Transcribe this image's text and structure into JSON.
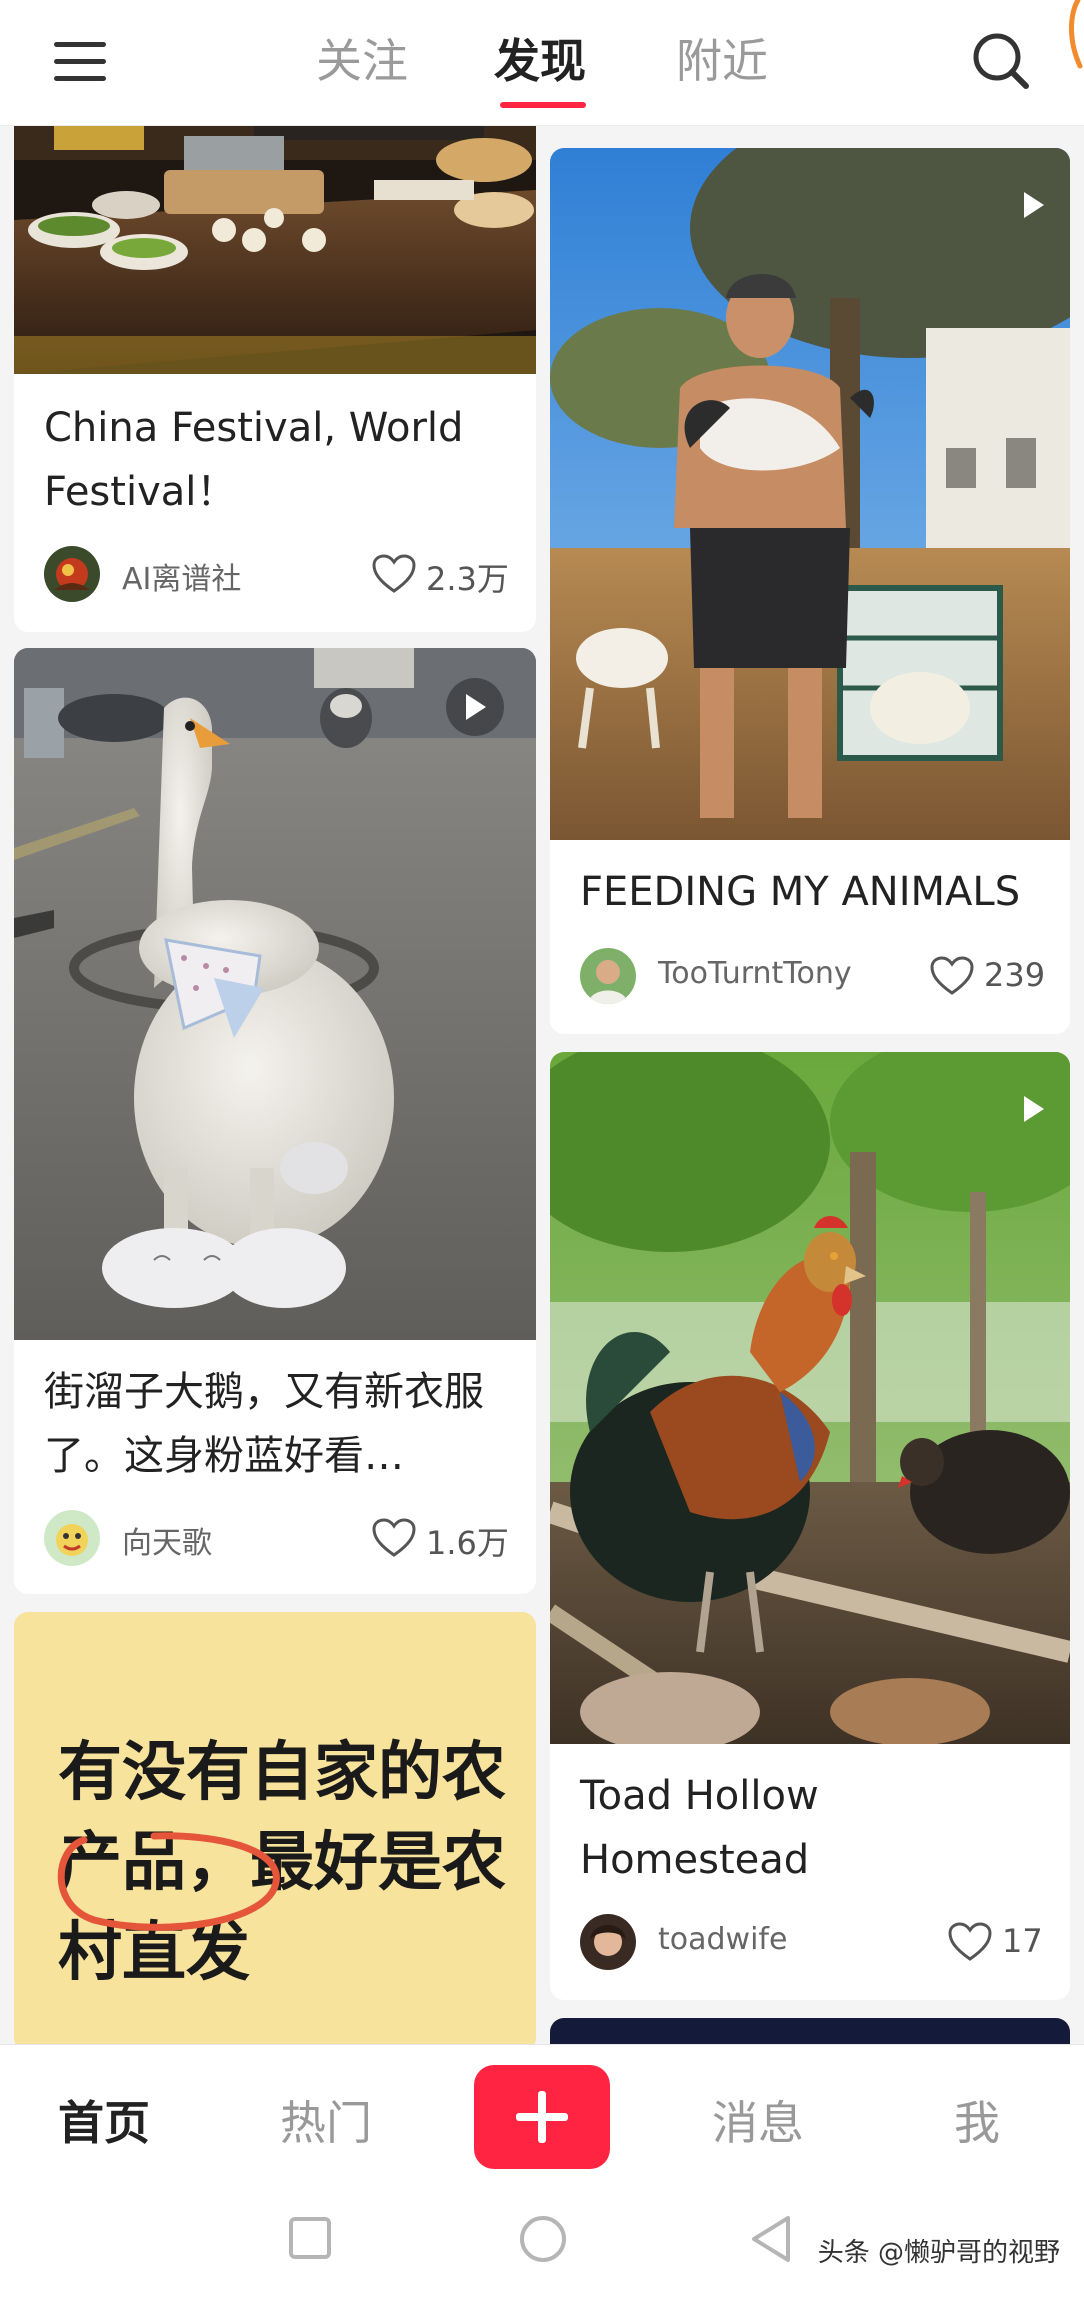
{
  "top_nav": {
    "tabs": [
      {
        "label": "关注"
      },
      {
        "label": "发现",
        "active": true
      },
      {
        "label": "附近"
      }
    ],
    "accent_color": "#ff2442"
  },
  "feed": [
    {
      "title": "China Festival, World Festival！",
      "author": "AI离谱社",
      "likes": "2.3万"
    },
    {
      "title": "街溜子大鹅，又有新衣服了。这身粉蓝好看…",
      "author": "向天歌",
      "likes": "1.6万",
      "is_video": true
    },
    {
      "cover_text": "有没有自家的农产品，最好是农村直发"
    },
    {
      "title": "FEEDING MY ANIMALS",
      "author": "TooTurntTony",
      "likes": "239",
      "is_video": true
    },
    {
      "title": "Toad Hollow Homestead",
      "author": "toadwife",
      "likes": "17",
      "is_video": true
    }
  ],
  "bottom_nav": {
    "items": [
      {
        "label": "首页",
        "active": true
      },
      {
        "label": "热门"
      },
      {
        "label": "+",
        "icon": "plus-icon"
      },
      {
        "label": "消息"
      },
      {
        "label": "我"
      }
    ]
  },
  "system_bar": {
    "buttons": [
      "square-icon",
      "circle-icon",
      "back-triangle-icon"
    ]
  },
  "watermark": "头条 @懒驴哥的视野"
}
